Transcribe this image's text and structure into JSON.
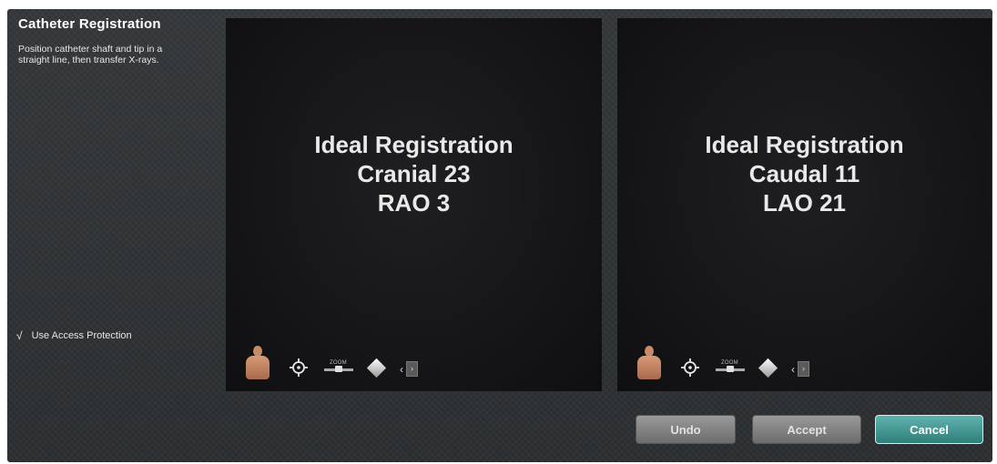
{
  "sidebar": {
    "title": "Catheter Registration",
    "instructions": "Position catheter shaft and tip in a straight line, then transfer X-rays.",
    "access_protection": {
      "checked": true,
      "check_mark": "√",
      "label": "Use Access Protection"
    }
  },
  "viewports": [
    {
      "line1": "Ideal Registration",
      "line2": "Cranial 23",
      "line3": "RAO 3",
      "toolbar": {
        "zoom_label": "ZOOM",
        "collapse_label": "‹"
      }
    },
    {
      "line1": "Ideal Registration",
      "line2": "Caudal 11",
      "line3": "LAO 21",
      "toolbar": {
        "zoom_label": "ZOOM",
        "collapse_label": "‹"
      }
    }
  ],
  "buttons": {
    "undo": "Undo",
    "accept": "Accept",
    "cancel": "Cancel"
  },
  "colors": {
    "background": "#2e3133",
    "viewport": "#151517",
    "cancel_accent": "#3f9590",
    "neutral_button": "#7f7f7f"
  },
  "icons": [
    "person-icon",
    "target-icon",
    "zoom-slider-icon",
    "diamond-icon",
    "collapse-icon"
  ]
}
